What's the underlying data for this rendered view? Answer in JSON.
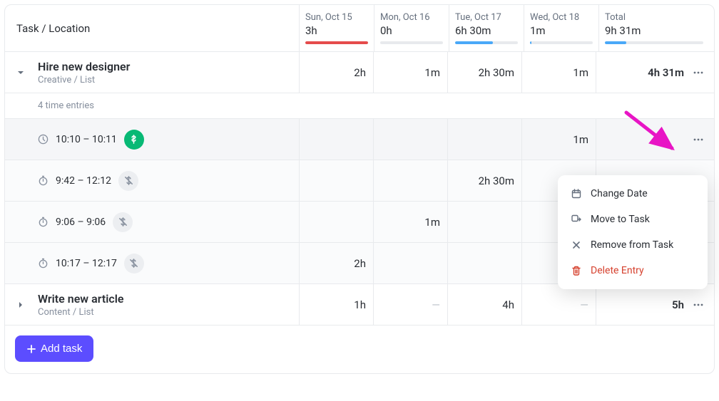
{
  "header": {
    "task_col": "Task / Location",
    "days": [
      {
        "label": "Sun, Oct 15",
        "total": "3h",
        "fill": 100,
        "color": "#e54b4b"
      },
      {
        "label": "Mon, Oct 16",
        "total": "0h",
        "fill": 0,
        "color": "#49a8f8"
      },
      {
        "label": "Tue, Oct 17",
        "total": "6h 30m",
        "fill": 60,
        "color": "#49a8f8"
      },
      {
        "label": "Wed, Oct 18",
        "total": "1m",
        "fill": 2,
        "color": "#49a8f8"
      }
    ],
    "total_label": "Total",
    "total_value": "9h 31m",
    "total_fill": 22,
    "total_color": "#49a8f8"
  },
  "tasks": [
    {
      "name": "Hire new designer",
      "location": "Creative / List",
      "expanded": true,
      "cells": [
        "2h",
        "1m",
        "2h 30m",
        "1m",
        "4h 31m"
      ],
      "entries_label": "4 time entries",
      "entries": [
        {
          "range": "10:10 – 10:11",
          "badge": "green",
          "cells": [
            "",
            "",
            "",
            "1m",
            ""
          ]
        },
        {
          "range": "9:42 – 12:12",
          "badge": "gray",
          "cells": [
            "",
            "",
            "2h 30m",
            "",
            ""
          ]
        },
        {
          "range": "9:06 – 9:06",
          "badge": "gray",
          "cells": [
            "",
            "1m",
            "",
            "",
            ""
          ]
        },
        {
          "range": "10:17 – 12:17",
          "badge": "gray",
          "cells": [
            "2h",
            "",
            "",
            "",
            ""
          ]
        }
      ]
    },
    {
      "name": "Write new article",
      "location": "Content / List",
      "expanded": false,
      "cells": [
        "1h",
        "—",
        "4h",
        "—",
        "5h"
      ]
    }
  ],
  "footer": {
    "add_task": "Add task"
  },
  "ctx": {
    "change_date": "Change Date",
    "move": "Move to Task",
    "remove": "Remove from Task",
    "delete": "Delete Entry"
  }
}
